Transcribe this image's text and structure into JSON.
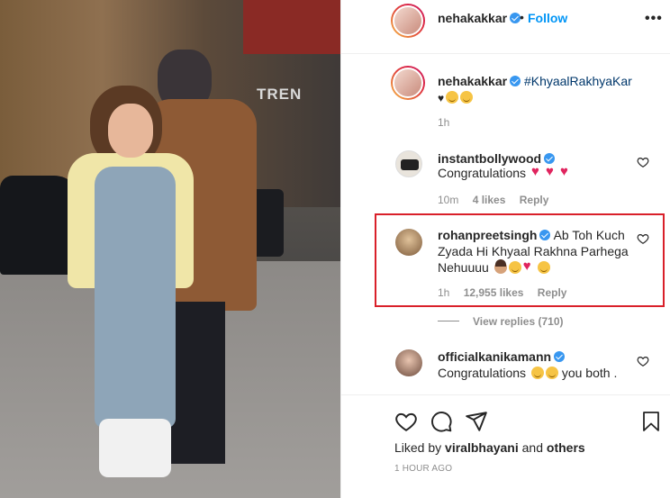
{
  "post": {
    "author": "nehakakkar",
    "follow_label": "Follow",
    "caption_user": "nehakakkar",
    "caption_hashtag": "#KhyaalRakhyaKar",
    "caption_time": "1h",
    "photo_sign_text": "TREN"
  },
  "comments": [
    {
      "user": "instantbollywood",
      "text": "Congratulations",
      "time": "10m",
      "likes": "4 likes",
      "reply": "Reply"
    },
    {
      "user": "rohanpreetsingh",
      "text_line1": "Ab Toh Kuch",
      "text_line2": "Zyada Hi Khyaal Rakhna Parhega",
      "text_line3": "Nehuuuu",
      "time": "1h",
      "likes": "12,955 likes",
      "reply": "Reply",
      "view_replies": "View replies (710)"
    },
    {
      "user": "officialkanikamann",
      "text_a": "Congratulations",
      "text_b": "you both ."
    }
  ],
  "footer": {
    "liked_by_prefix": "Liked by",
    "liked_by_user": "viralbhayani",
    "liked_by_and": "and",
    "liked_by_others": "others",
    "time_ago": "1 HOUR AGO"
  },
  "colors": {
    "link_blue": "#0095f6",
    "verified_blue": "#3897f0",
    "highlight_red": "#d9202a",
    "heart_red": "#e0245e"
  }
}
